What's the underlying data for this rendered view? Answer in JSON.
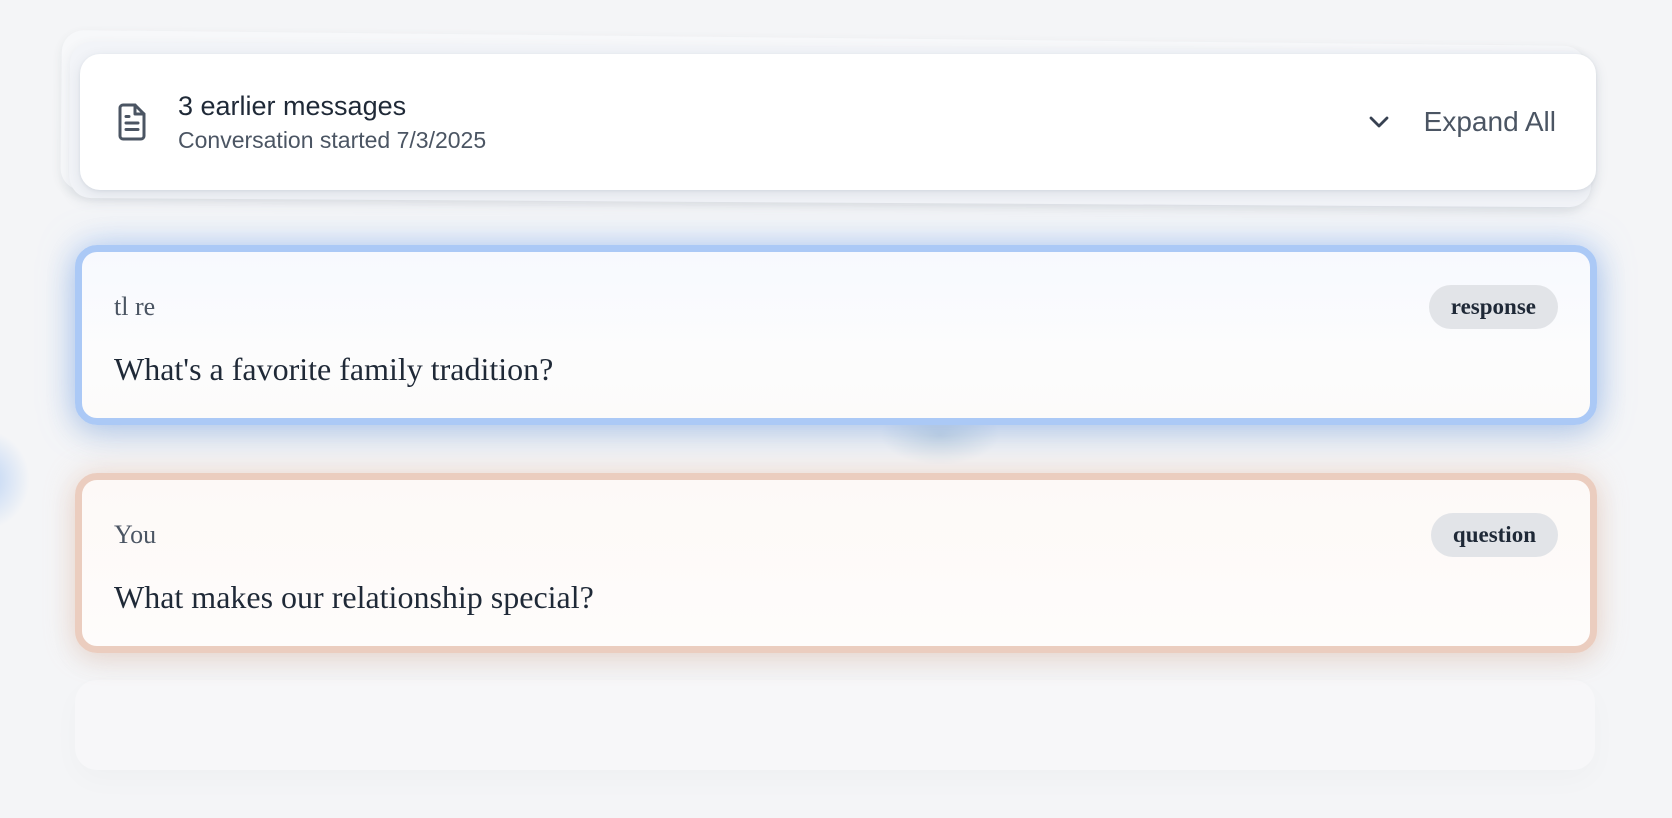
{
  "header": {
    "icon": "document-icon",
    "title": "3 earlier messages",
    "subtitle": "Conversation started 7/3/2025",
    "expand_icon": "chevron-down-icon",
    "expand_label": "Expand All"
  },
  "messages": [
    {
      "author": "tl re",
      "badge": "response",
      "text": "What's a favorite family tradition?",
      "accent_color": "#abc9f6"
    },
    {
      "author": "You",
      "badge": "question",
      "text": "What makes our relationship special?",
      "accent_color": "#ebcdbf"
    }
  ],
  "colors": {
    "background": "#f4f5f7",
    "badge_bg": "#e2e4e8",
    "text_primary": "#1f2937",
    "text_secondary": "#4b5563"
  }
}
